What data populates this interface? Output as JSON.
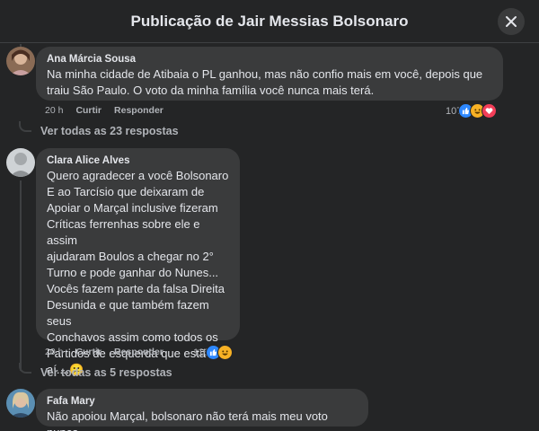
{
  "header": {
    "title": "Publicação de Jair Messias Bolsonaro"
  },
  "comments": [
    {
      "author": "Ana Márcia Sousa",
      "text": "Na minha cidade de Atibaia o PL ganhou, mas não confio mais em você, depois que\ntraiu São Paulo. O voto da minha família você nunca mais terá.",
      "time": "20 h",
      "like_label": "Curtir",
      "reply_label": "Responder",
      "reaction_count": "107",
      "reactions": [
        "like-icon",
        "haha-icon",
        "love-icon"
      ],
      "more_replies": "Ver todas as 23 respostas"
    },
    {
      "author": "Clara Alice Alves",
      "text": "Quero agradecer a você Bolsonaro\nE ao Tarcísio que deixaram de\nApoiar o Marçal inclusive fizeram\nCríticas ferrenhas sobre ele e assim\najudaram Boulos a chegar no 2°\nTurno e pode ganhar do Nunes...\nVocês fazem parte da falsa Direita\nDesunida e que também fazem seus\nConchavos assim como todos os\nPartidos de esquerda que estão\naí....",
      "emoji": "😕",
      "time": "20 h",
      "like_label": "Curtir",
      "reply_label": "Responder",
      "reaction_count": "116",
      "reactions": [
        "like-icon",
        "haha-icon"
      ],
      "more_replies": "Ver todas as 5 respostas"
    },
    {
      "author": "Fafa Mary",
      "text": "Não apoiou Marçal, bolsonaro não terá mais meu voto nunca"
    }
  ],
  "colors": {
    "like": "#2d88ff",
    "haha": "#f7b125",
    "love": "#f33e58",
    "background": "#242526",
    "bubble": "#3a3b3c"
  }
}
